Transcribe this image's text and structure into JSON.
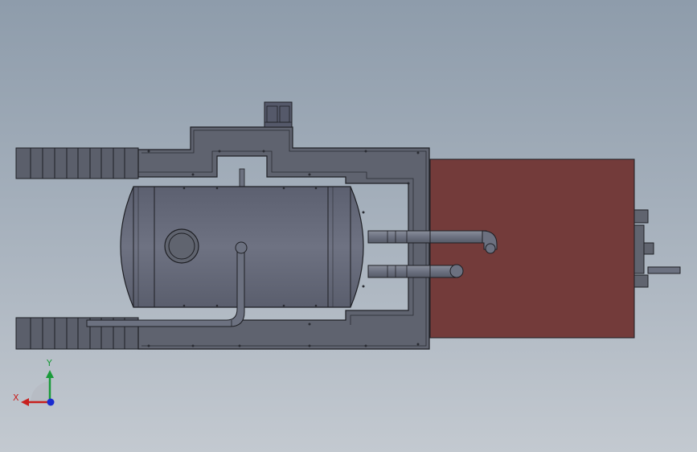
{
  "viewport": {
    "background_top": "#8e9cab",
    "background_bottom": "#c3c9d0"
  },
  "model": {
    "frame_color": "#5d616d",
    "tank_color": "#666a79",
    "pipe_color": "#6f7482",
    "box_color": "#733b3a",
    "edge_color": "#1e1f24"
  },
  "triad": {
    "x_label": "X",
    "y_label": "Y",
    "x_color": "#c8201e",
    "y_color": "#1a9a3a",
    "z_color": "#1a2bd0"
  }
}
